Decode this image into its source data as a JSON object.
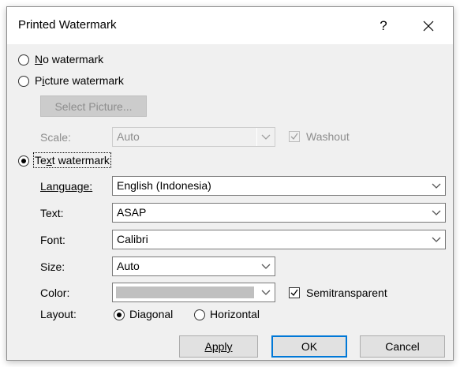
{
  "dialog": {
    "title": "Printed Watermark",
    "help_label": "?"
  },
  "options": {
    "no_watermark": {
      "label": "No watermark",
      "accesskey": "N",
      "rest": "o watermark"
    },
    "picture_watermark": {
      "label": "Picture watermark",
      "prefix": "P",
      "accesskey": "i",
      "rest": "cture watermark"
    },
    "text_watermark": {
      "label": "Text watermark",
      "prefix": "",
      "accesskey": "x",
      "pre": "Te",
      "rest": "t watermark"
    }
  },
  "picture": {
    "select_button": "Select Picture...",
    "scale_label": "Scale:",
    "scale_value": "Auto",
    "washout_label": "Washout",
    "washout_checked": true
  },
  "text_fields": {
    "language_label": "Language:",
    "language_value": "English (Indonesia)",
    "text_label": "Text:",
    "text_value": "ASAP",
    "font_label": "Font:",
    "font_value": "Calibri",
    "size_label": "Size:",
    "size_value": "Auto",
    "color_label": "Color:",
    "color_value": "#c0c0c0",
    "semitransparent_label": "Semitransparent",
    "semitransparent_checked": true,
    "layout_label": "Layout:",
    "layout_diagonal": "Diagonal",
    "layout_horizontal": "Horizontal",
    "layout_selected": "Diagonal"
  },
  "buttons": {
    "apply": "Apply",
    "ok": "OK",
    "cancel": "Cancel"
  },
  "colors": {
    "accent": "#0078d7",
    "dialog_bg": "#f0f0f0",
    "disabled_text": "#8d8d8d"
  }
}
